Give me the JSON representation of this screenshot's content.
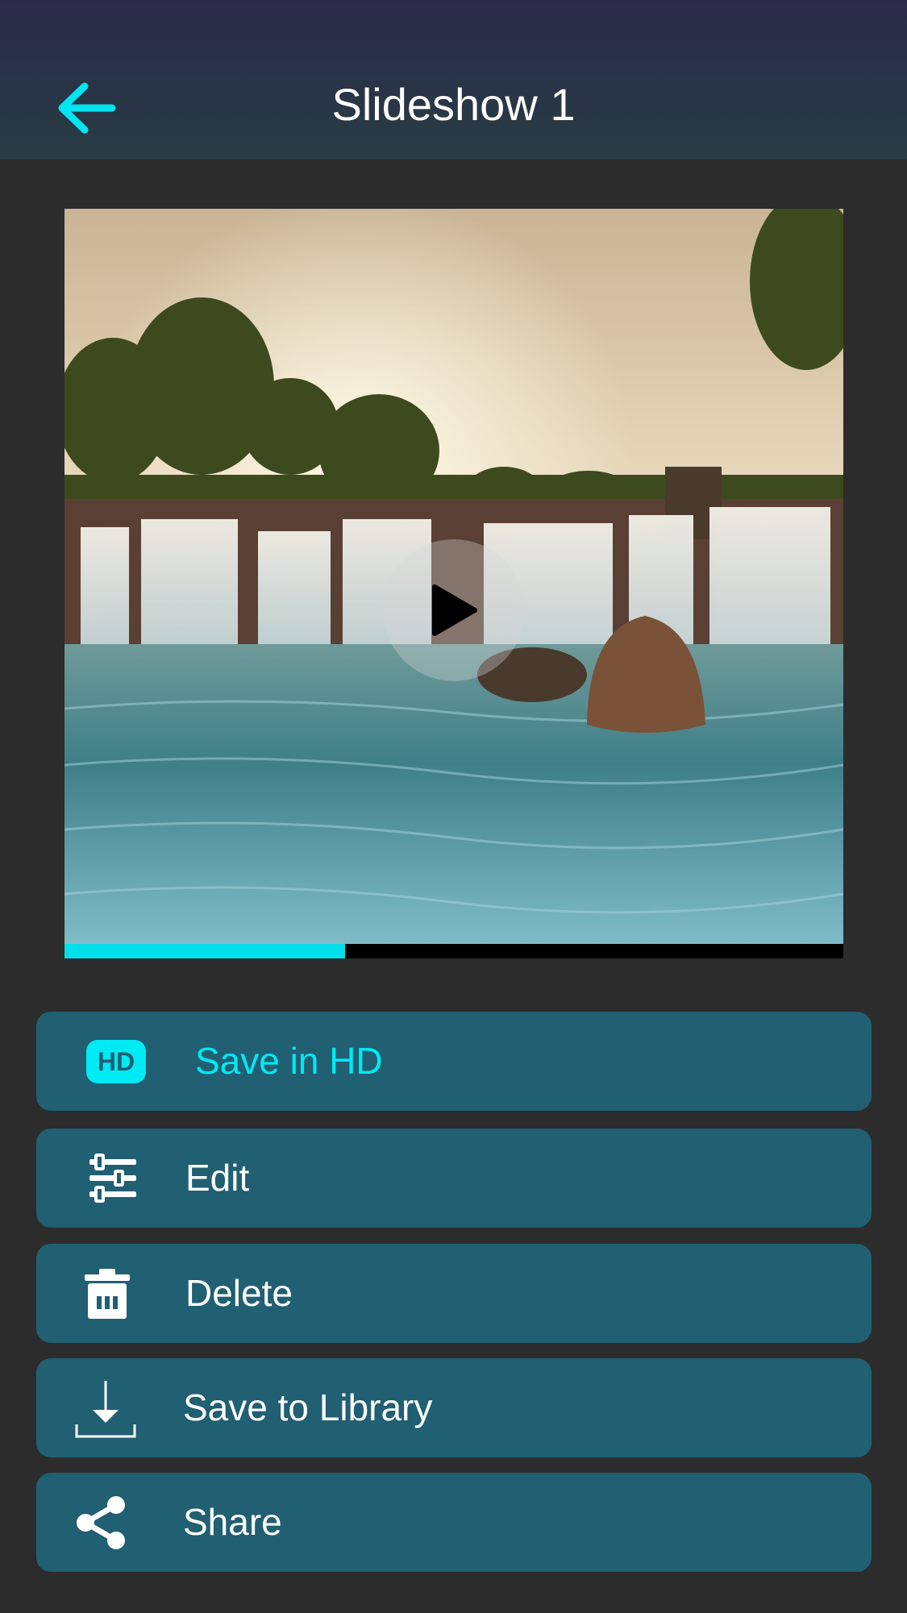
{
  "header": {
    "title": "Slideshow 1",
    "back_icon": "arrow-left-icon"
  },
  "player": {
    "progress": 0.36,
    "play_icon": "play-icon"
  },
  "actions": [
    {
      "id": "save-hd",
      "label": "Save in HD",
      "icon": "hd-icon",
      "badge": "HD",
      "color": "#00eaf3"
    },
    {
      "id": "edit",
      "label": "Edit",
      "icon": "sliders-icon"
    },
    {
      "id": "delete",
      "label": "Delete",
      "icon": "trash-icon"
    },
    {
      "id": "save-library",
      "label": "Save to Library",
      "icon": "download-icon"
    },
    {
      "id": "share",
      "label": "Share",
      "icon": "share-icon"
    }
  ],
  "colors": {
    "accent": "#00e5f0",
    "button_bg": "#215f73",
    "background": "#2c2c2c"
  }
}
